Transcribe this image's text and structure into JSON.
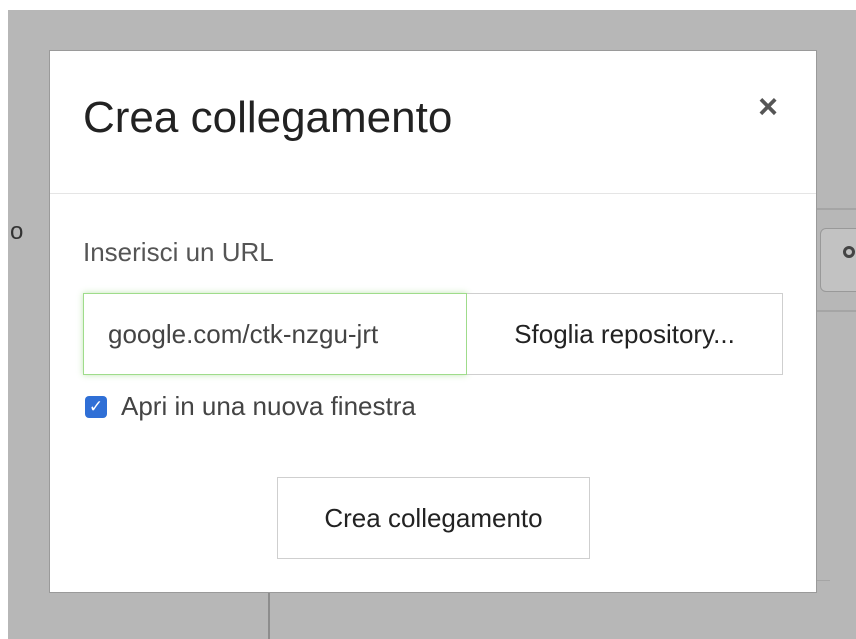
{
  "background": {
    "partial_letter": "o"
  },
  "modal": {
    "title": "Crea collegamento",
    "close_glyph": "×",
    "url_label": "Inserisci un URL",
    "url_value": "google.com/ctk-nzgu-jrt",
    "browse_label": "Sfoglia repository...",
    "new_window_label": "Apri in una nuova finestra",
    "new_window_checked": true,
    "submit_label": "Crea collegamento"
  },
  "colors": {
    "checkbox": "#2f6fd6",
    "input_focus_border": "#9fdc8b",
    "overlay": "#b7b7b7"
  },
  "icons": {
    "close": "close-icon",
    "checkmark": "check-icon",
    "search": "search-icon"
  }
}
